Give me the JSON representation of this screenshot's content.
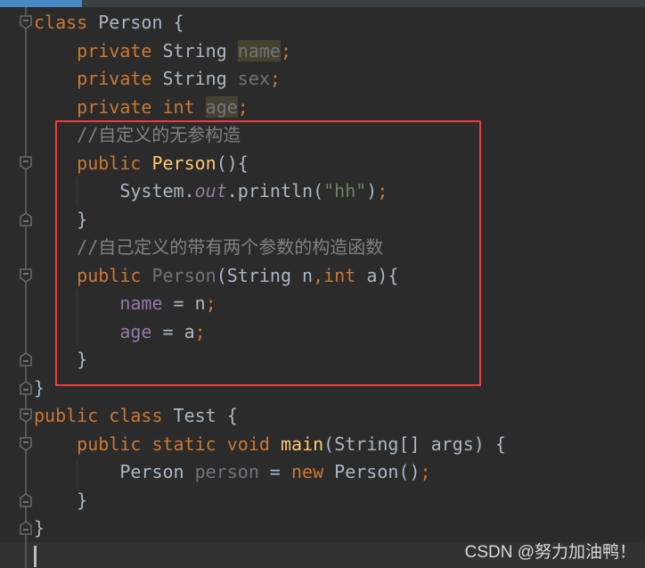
{
  "editor": {
    "lines": [
      [
        [
          "class ",
          "kw"
        ],
        [
          "Person ",
          "id"
        ],
        [
          "{",
          "id"
        ]
      ],
      [
        [
          "    ",
          ""
        ],
        [
          "private ",
          "kw"
        ],
        [
          "String ",
          "id"
        ],
        [
          "name",
          "unused hl"
        ],
        [
          ";",
          "kw"
        ]
      ],
      [
        [
          "    ",
          ""
        ],
        [
          "private ",
          "kw"
        ],
        [
          "String ",
          "id"
        ],
        [
          "sex",
          "unused"
        ],
        [
          ";",
          "kw"
        ]
      ],
      [
        [
          "    ",
          ""
        ],
        [
          "private ",
          "kw"
        ],
        [
          "int ",
          "kw"
        ],
        [
          "age",
          "unused hl"
        ],
        [
          ";",
          "kw"
        ]
      ],
      [
        [
          "    ",
          ""
        ],
        [
          "//自定义的无参构造",
          "cmt"
        ]
      ],
      [
        [
          "    ",
          ""
        ],
        [
          "public ",
          "kw"
        ],
        [
          "Person",
          "fn"
        ],
        [
          "(){",
          "id"
        ]
      ],
      [
        [
          "        ",
          ""
        ],
        [
          "System.",
          "id"
        ],
        [
          "out",
          "sfld"
        ],
        [
          ".println(",
          "id"
        ],
        [
          "\"hh\"",
          "str"
        ],
        [
          ")",
          "id"
        ],
        [
          ";",
          "kw"
        ]
      ],
      [
        [
          "    ",
          ""
        ],
        [
          "}",
          "id"
        ]
      ],
      [
        [
          "    ",
          ""
        ],
        [
          "//自己定义的带有两个参数的构造函数",
          "cmt"
        ]
      ],
      [
        [
          "    ",
          ""
        ],
        [
          "public ",
          "kw"
        ],
        [
          "Person",
          "unused"
        ],
        [
          "(String n",
          "id"
        ],
        [
          ",",
          "kw"
        ],
        [
          "int ",
          "kw"
        ],
        [
          "a){",
          "id"
        ]
      ],
      [
        [
          "        ",
          ""
        ],
        [
          "name",
          "fld"
        ],
        [
          " = n",
          "id"
        ],
        [
          ";",
          "kw"
        ]
      ],
      [
        [
          "        ",
          ""
        ],
        [
          "age",
          "fld"
        ],
        [
          " = a",
          "id"
        ],
        [
          ";",
          "kw"
        ]
      ],
      [
        [
          "    ",
          ""
        ],
        [
          "}",
          "id"
        ]
      ],
      [
        [
          "}",
          "id"
        ]
      ],
      [
        [
          "public ",
          "kw"
        ],
        [
          "class ",
          "kw"
        ],
        [
          "Test ",
          "id"
        ],
        [
          "{",
          "id"
        ]
      ],
      [
        [
          "    ",
          ""
        ],
        [
          "public ",
          "kw"
        ],
        [
          "static ",
          "kw"
        ],
        [
          "void ",
          "kw"
        ],
        [
          "main",
          "fn"
        ],
        [
          "(String[] args) {",
          "id"
        ]
      ],
      [
        [
          "        ",
          ""
        ],
        [
          "Person ",
          "id"
        ],
        [
          "person",
          "unused"
        ],
        [
          " = ",
          "id"
        ],
        [
          "new ",
          "kw"
        ],
        [
          "Person()",
          "id"
        ],
        [
          ";",
          "kw"
        ]
      ],
      [
        [
          "    ",
          ""
        ],
        [
          "}",
          "id"
        ]
      ],
      [
        [
          "}",
          "id"
        ]
      ]
    ],
    "fold_markers": [
      [
        0,
        "start"
      ],
      [
        5,
        "start"
      ],
      [
        7,
        "end"
      ],
      [
        9,
        "start"
      ],
      [
        12,
        "end"
      ],
      [
        13,
        "end"
      ],
      [
        14,
        "start"
      ],
      [
        15,
        "start"
      ],
      [
        17,
        "end"
      ],
      [
        18,
        "end"
      ]
    ]
  },
  "annotation": {
    "color": "#f03c3c",
    "label": "red highlight box around constructors"
  },
  "watermark": "CSDN @努力加油鸭！",
  "colors": {
    "background": "#2b2b2b",
    "keyword": "#cc7832",
    "field": "#9876aa",
    "function": "#ffc66d",
    "string": "#6a8759",
    "comment": "#808080"
  }
}
